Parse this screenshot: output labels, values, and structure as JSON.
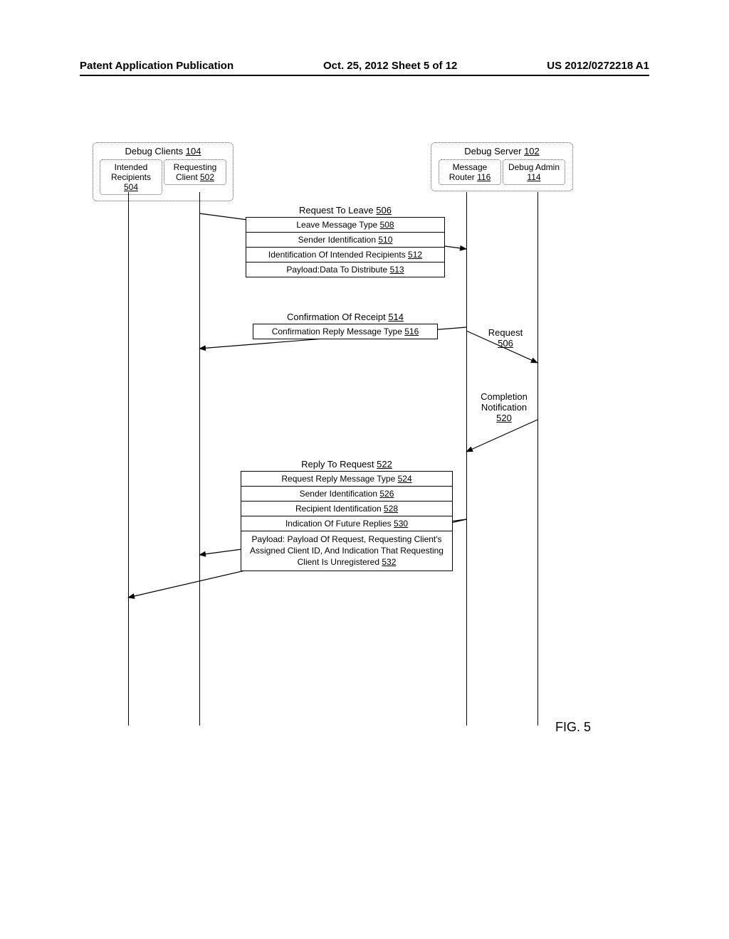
{
  "header": {
    "left": "Patent Application Publication",
    "middle": "Oct. 25, 2012  Sheet 5 of 12",
    "right": "US 2012/0272218 A1"
  },
  "clients_group": {
    "title": "Debug Clients",
    "title_ref": "104",
    "intended": {
      "label": "Intended Recipients",
      "ref": "504"
    },
    "requesting": {
      "label": "Requesting Client",
      "ref": "502"
    }
  },
  "server_group": {
    "title": "Debug Server",
    "title_ref": "102",
    "router": {
      "label": "Message Router",
      "ref": "116"
    },
    "admin": {
      "label": "Debug Admin",
      "ref": "114"
    }
  },
  "msg1": {
    "title": "Request To Leave",
    "title_ref": "506",
    "rows": [
      {
        "text": "Leave Message Type",
        "ref": "508"
      },
      {
        "text": "Sender Identification",
        "ref": "510"
      },
      {
        "text": "Identification Of Intended Recipients",
        "ref": "512"
      },
      {
        "text": "Payload:Data To Distribute",
        "ref": "513"
      }
    ]
  },
  "msg2": {
    "title": "Confirmation Of Receipt",
    "title_ref": "514",
    "rows": [
      {
        "text": "Confirmation Reply Message Type",
        "ref": "516"
      }
    ]
  },
  "side1": {
    "text": "Request",
    "ref": "506"
  },
  "side2": {
    "text": "Completion Notification",
    "ref": "520"
  },
  "msg3": {
    "title": "Reply To Request",
    "title_ref": "522",
    "rows": [
      {
        "text": "Request Reply Message Type",
        "ref": "524"
      },
      {
        "text": "Sender Identification",
        "ref": "526"
      },
      {
        "text": "Recipient Identification",
        "ref": "528"
      },
      {
        "text": "Indication Of Future Replies",
        "ref": "530"
      },
      {
        "text": "Payload: Payload Of Request, Requesting Client's Assigned Client ID, And Indication That Requesting Client Is Unregistered",
        "ref": "532"
      }
    ]
  },
  "figure_label": "FIG. 5"
}
